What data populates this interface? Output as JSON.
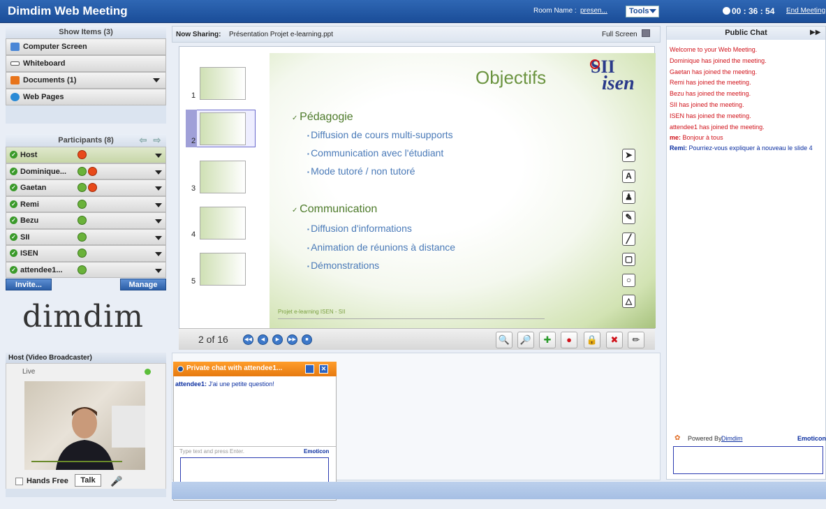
{
  "app": {
    "title": "Dimdim Web Meeting"
  },
  "topbar": {
    "room_label": "Room Name :",
    "room_value": "presen...",
    "tools": "Tools",
    "timer": "00 : 36 : 54",
    "end": "End Meeting"
  },
  "show_items": {
    "header": "Show Items (3)",
    "items": [
      {
        "label": "Computer Screen",
        "icon": "monitor-icon"
      },
      {
        "label": "Whiteboard",
        "icon": "pencil-icon"
      },
      {
        "label": "Documents (1)",
        "icon": "document-icon"
      },
      {
        "label": "Web Pages",
        "icon": "globe-icon"
      }
    ]
  },
  "participants": {
    "header": "Participants (8)",
    "list": [
      {
        "name": "Host"
      },
      {
        "name": "Dominique..."
      },
      {
        "name": "Gaetan"
      },
      {
        "name": "Remi"
      },
      {
        "name": "Bezu"
      },
      {
        "name": "SII"
      },
      {
        "name": "ISEN"
      },
      {
        "name": "attendee1..."
      }
    ],
    "invite": "Invite...",
    "manage": "Manage"
  },
  "logo": "dimdim",
  "video": {
    "header": "Host (Video Broadcaster)",
    "status": "Live",
    "hands_free": "Hands Free",
    "talk": "Talk"
  },
  "sharing": {
    "label": "Now Sharing:",
    "file": "Présentation Projet e-learning.ppt",
    "fullscreen": "Full Screen"
  },
  "slide": {
    "title": "Objectifs",
    "bullets": [
      {
        "text": "Pédagogie",
        "subs": [
          "Diffusion de cours multi-supports",
          "Communication avec l'étudiant",
          "Mode tutoré / non tutoré"
        ]
      },
      {
        "text": "Communication",
        "subs": [
          "Diffusion d'informations",
          "Animation de réunions à distance",
          "Démonstrations"
        ]
      }
    ],
    "footer": "Projet e-learning ISEN - SII",
    "logo_text": "isen"
  },
  "thumbnails": [
    "1",
    "2",
    "3",
    "4",
    "5"
  ],
  "navigation": {
    "page_indicator": "2 of 16"
  },
  "private_chat": {
    "title": "Private chat with attendee1...",
    "sender": "attendee1:",
    "message": "J'ai une petite question!",
    "hint": "Type text and press Enter.",
    "emoticon": "Emoticon"
  },
  "public_chat": {
    "header": "Public Chat",
    "system_messages": [
      "Welcome to your Web Meeting.",
      "Dominique has joined the meeting.",
      "Gaetan has joined the meeting.",
      "Remi has joined the meeting.",
      "Bezu has joined the meeting.",
      "SII has joined the meeting.",
      "ISEN has joined the meeting.",
      "attendee1 has joined the meeting."
    ],
    "me_sender": "me:",
    "me_text": "Bonjour à tous",
    "remi_sender": "Remi:",
    "remi_text": "Pourriez-vous expliquer à nouveau le slide 4",
    "powered_by": "Powered By",
    "powered_link": "Dimdim",
    "emoticon": "Emoticon"
  }
}
